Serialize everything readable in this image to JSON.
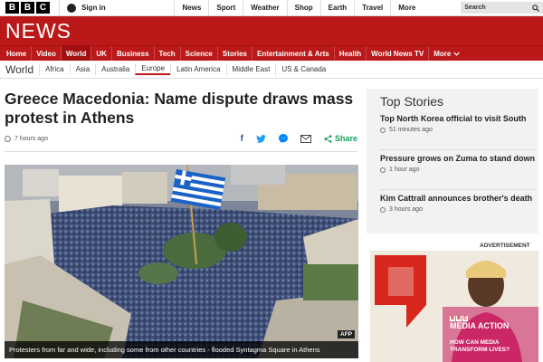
{
  "topbar": {
    "logo_letters": [
      "B",
      "B",
      "C"
    ],
    "signin": "Sign in",
    "nav": [
      "News",
      "Sport",
      "Weather",
      "Shop",
      "Earth",
      "Travel",
      "More"
    ],
    "search_placeholder": "Search"
  },
  "brand": {
    "section_name": "NEWS",
    "color": "#bb1919"
  },
  "main_nav": {
    "items": [
      "Home",
      "Video",
      "World",
      "UK",
      "Business",
      "Tech",
      "Science",
      "Stories",
      "Entertainment & Arts",
      "Health",
      "World News TV",
      "More"
    ],
    "active": "World"
  },
  "sub_nav": {
    "section": "World",
    "items": [
      "Africa",
      "Asia",
      "Australia",
      "Europe",
      "Latin America",
      "Middle East",
      "US & Canada"
    ],
    "active": "Europe"
  },
  "article": {
    "headline": "Greece Macedonia: Name dispute draws mass protest in Athens",
    "time": "7 hours ago",
    "share_label": "Share",
    "photo_caption": "Protesters from far and wide, including some from other countries - flooded Syntagma Square in Athens",
    "photo_credit": "AFP"
  },
  "top_stories": {
    "title": "Top Stories",
    "items": [
      {
        "headline": "Top North Korea official to visit South",
        "time": "51 minutes ago"
      },
      {
        "headline": "Pressure grows on Zuma to stand down",
        "time": "1 hour ago"
      },
      {
        "headline": "Kim Cattrall announces brother's death",
        "time": "3 hours ago"
      }
    ]
  },
  "advert": {
    "label": "ADVERTISEMENT",
    "brand_letters": [
      "B",
      "B",
      "C"
    ],
    "brand": "MEDIA ACTION",
    "tagline": "HOW CAN MEDIA TRANSFORM LIVES?"
  }
}
